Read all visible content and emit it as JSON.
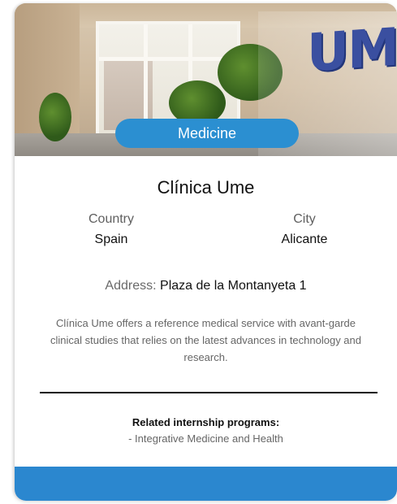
{
  "card": {
    "category": "Medicine",
    "title": "Clínica Ume",
    "country_label": "Country",
    "country_value": "Spain",
    "city_label": "City",
    "city_value": "Alicante",
    "address_label": "Address:",
    "address_value": "Plaza de la Montanyeta 1",
    "description": "Clínica Ume offers a reference medical service with avant-garde clinical studies that relies on the latest advances in technology and research.",
    "related_heading": "Related internship programs:",
    "related_programs": [
      "- Integrative Medicine and Health"
    ]
  },
  "photo": {
    "wall_logo_text": "UME"
  },
  "colors": {
    "accent": "#2b8fd1",
    "footer": "#2b87cf",
    "text_dark": "#111111",
    "text_muted": "#666666"
  }
}
